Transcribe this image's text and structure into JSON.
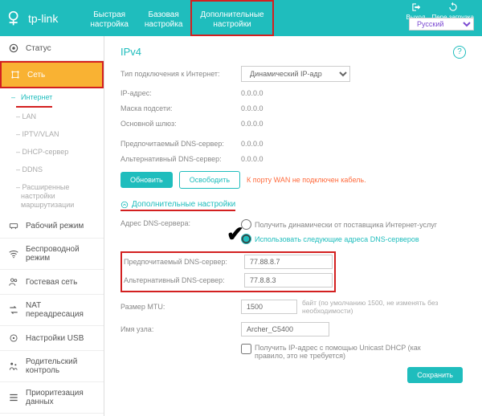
{
  "header": {
    "brand": "tp-link",
    "tabs": [
      {
        "line1": "Быстрая",
        "line2": "настройка"
      },
      {
        "line1": "Базовая",
        "line2": "настройка"
      },
      {
        "line1": "Дополнительные",
        "line2": "настройки"
      }
    ],
    "logout": "Выход",
    "reload": "Пере загрузка",
    "lang": "Русский"
  },
  "sidebar": {
    "items": [
      {
        "label": "Статус"
      },
      {
        "label": "Сеть"
      },
      {
        "label": "Рабочий режим"
      },
      {
        "label": "Беспроводной режим"
      },
      {
        "label": "Гостевая сеть"
      },
      {
        "label": "NAT переадресация"
      },
      {
        "label": "Настройки USB"
      },
      {
        "label": "Родительский контроль"
      },
      {
        "label": "Приоритезация данных"
      }
    ],
    "sub": [
      {
        "label": "Интернет"
      },
      {
        "label": "LAN"
      },
      {
        "label": "IPTV/VLAN"
      },
      {
        "label": "DHCP-сервер"
      },
      {
        "label": "DDNS"
      },
      {
        "label": "Расширенные настройки маршрутизации"
      }
    ]
  },
  "main": {
    "title": "IPv4",
    "conn_type_lbl": "Тип подключения к Интернет:",
    "conn_type_val": "Динамический IP-адр",
    "ip_lbl": "IP-адрес:",
    "ip_val": "0.0.0.0",
    "mask_lbl": "Маска подсети:",
    "mask_val": "0.0.0.0",
    "gw_lbl": "Основной шлюз:",
    "gw_val": "0.0.0.0",
    "dns1_lbl": "Предпочитаемый DNS-сервер:",
    "dns1_val": "0.0.0.0",
    "dns2_lbl": "Альтернативный DNS-сервер:",
    "dns2_val": "0.0.0.0",
    "btn_update": "Обновить",
    "btn_release": "Освободить",
    "wan_warn": "К порту WAN не подключен кабель.",
    "adv_title": "Дополнительные настройки",
    "dns_addr_lbl": "Адрес DNS-сервера:",
    "radio_auto": "Получить динамически от поставщика Интернет-услуг",
    "radio_manual": "Использовать следующие адреса DNS-серверов",
    "pref_dns_lbl": "Предпочитаемый DNS-сервер:",
    "pref_dns_val": "77.88.8.7",
    "alt_dns_lbl": "Альтернативный DNS-сервер:",
    "alt_dns_val": "77.8.8.3",
    "mtu_lbl": "Размер MTU:",
    "mtu_val": "1500",
    "mtu_hint": "байт (по умолчанию 1500, не изменять без необходимости)",
    "host_lbl": "Имя узла:",
    "host_val": "Archer_C5400",
    "unicast_lbl": "Получить IP-адрес с помощью Unicast DHCP (как правило, это не требуется)",
    "btn_save": "Сохранить"
  }
}
